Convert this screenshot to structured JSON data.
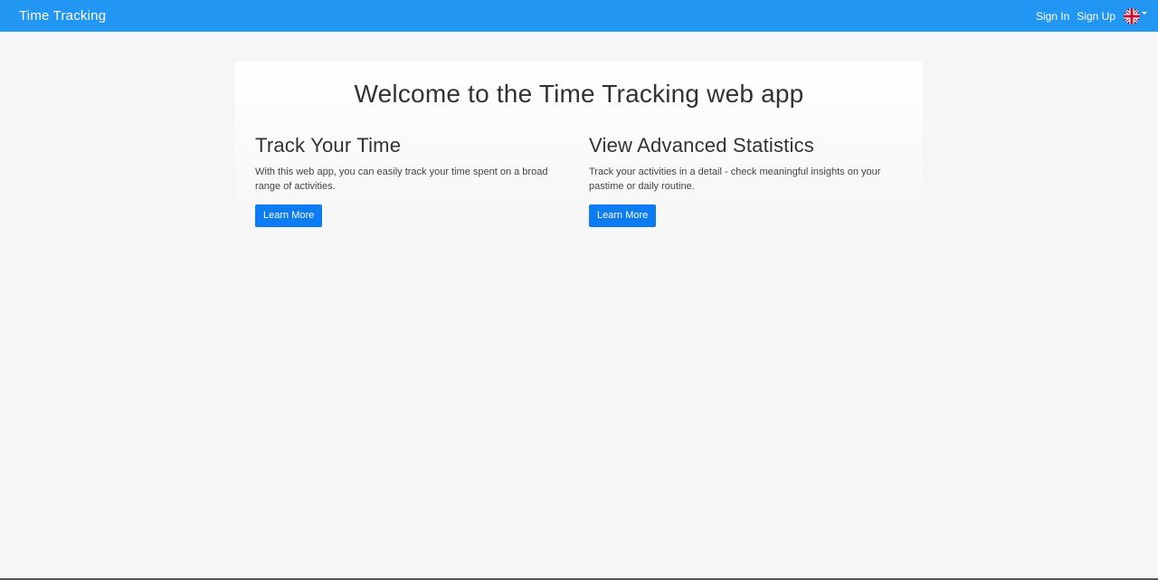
{
  "navbar": {
    "brand": "Time Tracking",
    "links": [
      "Sign In",
      "Sign Up"
    ],
    "language_icon": "uk-flag-icon"
  },
  "jumbotron": {
    "title": "Welcome to the Time Tracking web app",
    "features": [
      {
        "heading": "Track Your Time",
        "text": "With this web app, you can easily track your time spent on a broad range of activities.",
        "button": "Learn More"
      },
      {
        "heading": "View Advanced Statistics",
        "text": "Track your activities in a detail - check meaningful insights on your pastime or daily routine.",
        "button": "Learn More"
      }
    ]
  },
  "colors": {
    "navbar": "#2196f3",
    "button": "#0d7bf2",
    "background": "#f6f6f6"
  }
}
